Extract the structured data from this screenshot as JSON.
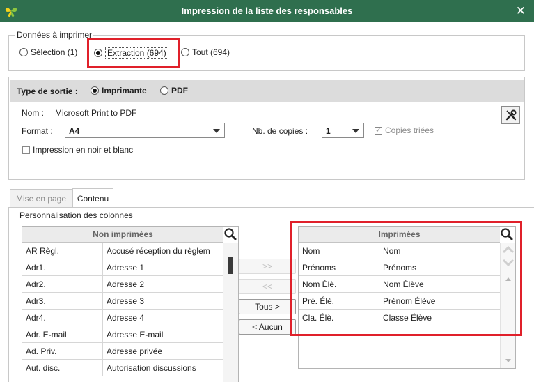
{
  "window": {
    "title": "Impression de la liste des responsables"
  },
  "data_section": {
    "legend": "Données à imprimer",
    "options": [
      {
        "label": "Sélection (1)",
        "selected": false
      },
      {
        "label": "Extraction (694)",
        "selected": true
      },
      {
        "label": "Tout (694)",
        "selected": false
      }
    ]
  },
  "output": {
    "label": "Type de sortie :",
    "options": [
      {
        "label": "Imprimante",
        "selected": true
      },
      {
        "label": "PDF",
        "selected": false
      }
    ],
    "name_label": "Nom :",
    "name_value": "Microsoft Print to PDF",
    "format_label": "Format :",
    "format_value": "A4",
    "copies_label": "Nb. de copies :",
    "copies_value": "1",
    "collate_label": "Copies triées",
    "bw_label": "Impression en noir et blanc"
  },
  "tabs": [
    {
      "label": "Mise en page",
      "active": false
    },
    {
      "label": "Contenu",
      "active": true
    }
  ],
  "columns": {
    "legend": "Personnalisation des colonnes",
    "left": {
      "header": "Non imprimées",
      "rows": [
        [
          "AR Règl.",
          "Accusé réception du règlem"
        ],
        [
          "Adr1.",
          "Adresse 1"
        ],
        [
          "Adr2.",
          "Adresse 2"
        ],
        [
          "Adr3.",
          "Adresse 3"
        ],
        [
          "Adr4.",
          "Adresse 4"
        ],
        [
          "Adr. E-mail",
          "Adresse E-mail"
        ],
        [
          "Ad. Priv.",
          "Adresse privée"
        ],
        [
          "Aut. disc.",
          "Autorisation discussions"
        ]
      ]
    },
    "right": {
      "header": "Imprimées",
      "rows": [
        [
          "Nom",
          "Nom"
        ],
        [
          "Prénoms",
          "Prénoms"
        ],
        [
          "Nom Élè.",
          "Nom Élève"
        ],
        [
          "Pré. Élè.",
          "Prénom Élève"
        ],
        [
          "Cla. Élè.",
          "Classe Élève"
        ]
      ]
    },
    "buttons": [
      {
        "label": ">>",
        "enabled": false
      },
      {
        "label": "<<",
        "enabled": false
      },
      {
        "label": "Tous >",
        "enabled": true
      },
      {
        "label": "< Aucun",
        "enabled": true
      }
    ]
  },
  "colors": {
    "titlebar": "#2f6f4e",
    "highlight": "#e0202a"
  }
}
